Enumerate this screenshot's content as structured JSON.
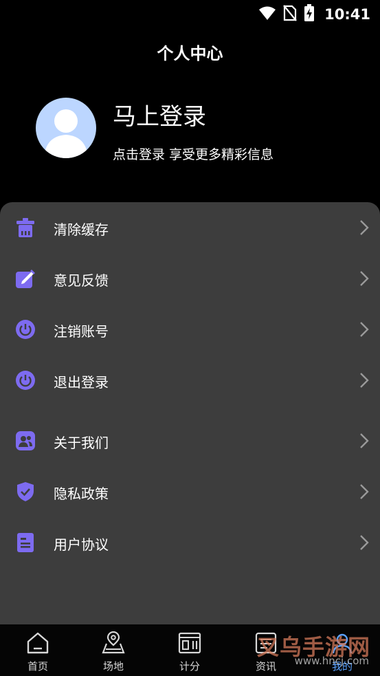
{
  "status_bar": {
    "time": "10:41",
    "icons": [
      "wifi-icon",
      "no-sim-icon",
      "battery-charging-icon"
    ]
  },
  "header": {
    "title": "个人中心"
  },
  "profile": {
    "avatar_icon": "default-avatar-icon",
    "login_title": "马上登录",
    "login_subtitle": "点击登录 享受更多精彩信息"
  },
  "menu": {
    "accent_color": "#7d6bf0",
    "items": [
      {
        "icon": "trash-icon",
        "label": "清除缓存"
      },
      {
        "icon": "edit-icon",
        "label": "意见反馈"
      },
      {
        "icon": "power-icon",
        "label": "注销账号"
      },
      {
        "icon": "power-icon",
        "label": "退出登录"
      },
      {
        "icon": "team-icon",
        "label": "关于我们"
      },
      {
        "icon": "shield-check-icon",
        "label": "隐私政策"
      },
      {
        "icon": "document-icon",
        "label": "用户协议"
      }
    ]
  },
  "tabs": {
    "active_color": "#5aa2ff",
    "items": [
      {
        "icon": "home-icon",
        "label": "首页"
      },
      {
        "icon": "location-icon",
        "label": "场地"
      },
      {
        "icon": "scoreboard-icon",
        "label": "计分"
      },
      {
        "icon": "news-icon",
        "label": "资讯"
      },
      {
        "icon": "user-icon",
        "label": "我的"
      }
    ]
  },
  "watermark": {
    "text": "叉乌手游网",
    "url": "www.hncj.com"
  }
}
